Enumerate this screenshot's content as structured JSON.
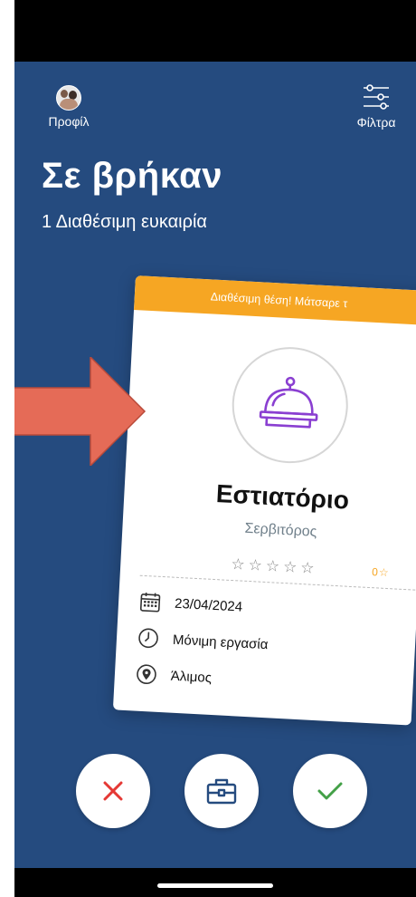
{
  "header": {
    "profile_label": "Προφίλ",
    "filters_label": "Φίλτρα",
    "title": "Σε βρήκαν",
    "subtitle": "1 Διαθέσιμη ευκαιρία"
  },
  "card": {
    "banner_text": "Διαθέσιμη θέση! Μάτσαρε τ",
    "category": "Εστιατόριο",
    "position": "Σερβιτόρος",
    "rating_stars": 5,
    "rating_value": "0",
    "date": "23/04/2024",
    "employment_type": "Μόνιμη εργασία",
    "location": "Άλιμος"
  },
  "actions": {
    "reject_icon": "close-icon",
    "details_icon": "briefcase-icon",
    "accept_icon": "check-icon"
  },
  "colors": {
    "background": "#254b7f",
    "banner": "#f6a623",
    "reject": "#e53935",
    "accept": "#43a047",
    "arrow": "#e56b57",
    "bell": "#8a3fd1"
  }
}
